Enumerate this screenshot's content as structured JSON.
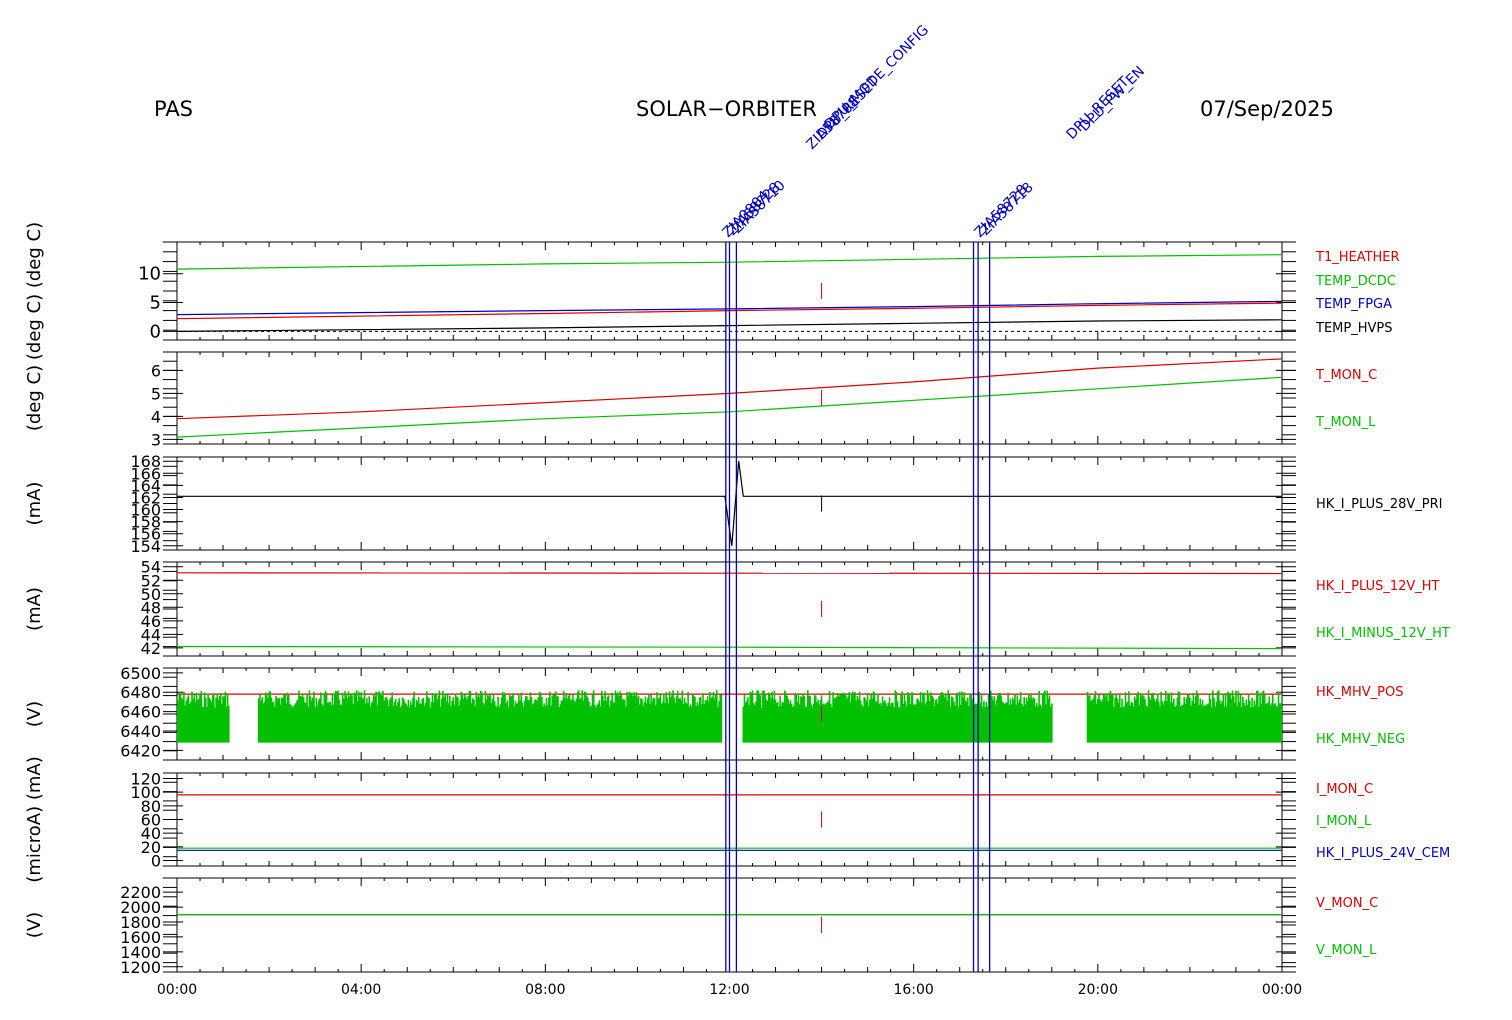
{
  "header": {
    "left": "PAS",
    "center": "SOLAR−ORBITER",
    "right": "07/Sep/2025"
  },
  "colors": {
    "red": "#dd0000",
    "green": "#00c000",
    "blue": "#0000c0",
    "black": "#000000"
  },
  "event_annotations": [
    "ZIA0804",
    "ZIA58728",
    "ZIA58710",
    "ZIA58708",
    "DPU_RESET",
    "DPU_MODE_CONFIG",
    "ZIA58728",
    "ZIA58718",
    "DPU_RESET",
    "DPU_PW_EN"
  ],
  "chart_data": {
    "type": "line",
    "x_axis": {
      "start": "00:00",
      "end": "00:00",
      "tick_labels": [
        "00:00",
        "04:00",
        "08:00",
        "12:00",
        "16:00",
        "20:00",
        "00:00"
      ]
    },
    "event_lines_hours": [
      11.92,
      12.0,
      12.15,
      17.3,
      17.4,
      17.65
    ],
    "panels": [
      {
        "ylabel": "(deg C)  (deg C)",
        "ylim": [
          -1.5,
          15.5
        ],
        "yticks": [
          "0",
          "5",
          "10"
        ],
        "ytick_values": [
          0,
          5,
          10
        ],
        "dashed_zero": true,
        "series": [
          {
            "name": "T1_HEATHER",
            "color": "red",
            "points": [
              [
                0,
                2.2
              ],
              [
                8,
                3.1
              ],
              [
                12,
                3.6
              ],
              [
                16,
                4.0
              ],
              [
                20,
                4.5
              ],
              [
                24,
                4.9
              ]
            ]
          },
          {
            "name": "TEMP_DCDC",
            "color": "green",
            "points": [
              [
                0,
                10.8
              ],
              [
                8,
                11.7
              ],
              [
                12,
                12.0
              ],
              [
                16,
                12.5
              ],
              [
                20,
                13.0
              ],
              [
                24,
                13.3
              ]
            ]
          },
          {
            "name": "TEMP_FPGA",
            "color": "blue",
            "points": [
              [
                0,
                2.9
              ],
              [
                8,
                3.6
              ],
              [
                12,
                3.9
              ],
              [
                16,
                4.3
              ],
              [
                20,
                4.8
              ],
              [
                24,
                5.2
              ]
            ]
          },
          {
            "name": "TEMP_HVPS",
            "color": "black",
            "points": [
              [
                0,
                0.0
              ],
              [
                8,
                0.6
              ],
              [
                12,
                1.0
              ],
              [
                16,
                1.4
              ],
              [
                20,
                1.8
              ],
              [
                24,
                2.0
              ]
            ]
          }
        ]
      },
      {
        "ylabel": "(deg C)",
        "ylim": [
          2.8,
          6.8
        ],
        "yticks": [
          "3",
          "4",
          "5",
          "6"
        ],
        "ytick_values": [
          3,
          4,
          5,
          6
        ],
        "series": [
          {
            "name": "T_MON_C",
            "color": "red",
            "points": [
              [
                0,
                3.9
              ],
              [
                4,
                4.2
              ],
              [
                8,
                4.6
              ],
              [
                12,
                5.0
              ],
              [
                16,
                5.5
              ],
              [
                20,
                6.1
              ],
              [
                24,
                6.5
              ]
            ]
          },
          {
            "name": "T_MON_L",
            "color": "green",
            "points": [
              [
                0,
                3.1
              ],
              [
                4,
                3.5
              ],
              [
                8,
                3.9
              ],
              [
                12,
                4.2
              ],
              [
                16,
                4.7
              ],
              [
                20,
                5.2
              ],
              [
                24,
                5.7
              ]
            ]
          }
        ]
      },
      {
        "ylabel": "(mA)",
        "ylim": [
          153.3,
          168.7
        ],
        "yticks": [
          "154",
          "156",
          "158",
          "160",
          "162",
          "164",
          "166",
          "168"
        ],
        "ytick_values": [
          154,
          156,
          158,
          160,
          162,
          164,
          166,
          168
        ],
        "series": [
          {
            "name": "HK_I_PLUS_28V_PRI",
            "color": "black",
            "points": [
              [
                0,
                162.2
              ],
              [
                11.9,
                162.2
              ],
              [
                12.05,
                154.0
              ],
              [
                12.2,
                168.0
              ],
              [
                12.3,
                162.2
              ],
              [
                24,
                162.2
              ]
            ]
          }
        ]
      },
      {
        "ylabel": "(mA)",
        "ylim": [
          40.8,
          54.7
        ],
        "yticks": [
          "42",
          "44",
          "46",
          "48",
          "50",
          "52",
          "54"
        ],
        "ytick_values": [
          42,
          44,
          46,
          48,
          50,
          52,
          54
        ],
        "series": [
          {
            "name": "HK_I_PLUS_12V_HT",
            "color": "red",
            "points": [
              [
                0,
                53.1
              ],
              [
                24,
                53.0
              ]
            ]
          },
          {
            "name": "HK_I_MINUS_12V_HT",
            "color": "green",
            "points": [
              [
                0,
                42.2
              ],
              [
                12,
                42.1
              ],
              [
                24,
                41.9
              ]
            ]
          }
        ]
      },
      {
        "ylabel": "(V)",
        "ylim": [
          6410,
          6505
        ],
        "yticks": [
          "6420",
          "6440",
          "6460",
          "6480",
          "6500"
        ],
        "ytick_values": [
          6420,
          6440,
          6460,
          6480,
          6500
        ],
        "series": [
          {
            "name": "HK_MHV_POS",
            "color": "red",
            "points": [
              [
                0,
                6478
              ],
              [
                24,
                6478
              ]
            ]
          },
          {
            "name": "HK_MHV_NEG",
            "color": "green",
            "band": [
              6428,
              6482
            ],
            "gaps_hours": [
              [
                1.15,
                1.75
              ],
              [
                11.85,
                12.3
              ],
              [
                19.0,
                19.75
              ]
            ]
          }
        ]
      },
      {
        "ylabel": "(microA)  (mA)",
        "ylim": [
          -8,
          128
        ],
        "yticks": [
          "0",
          "20",
          "40",
          "60",
          "80",
          "100",
          "120"
        ],
        "ytick_values": [
          0,
          20,
          40,
          60,
          80,
          100,
          120
        ],
        "series": [
          {
            "name": "I_MON_C",
            "color": "red",
            "points": [
              [
                0,
                96
              ],
              [
                12,
                96
              ],
              [
                24,
                96
              ]
            ]
          },
          {
            "name": "I_MON_L",
            "color": "green",
            "points": [
              [
                0,
                18
              ],
              [
                24,
                18
              ]
            ]
          },
          {
            "name": "HK_I_PLUS_24V_CEM",
            "color": "blue",
            "points": [
              [
                0,
                15
              ],
              [
                24,
                15
              ]
            ]
          }
        ]
      },
      {
        "ylabel": "(V)",
        "ylim": [
          1130,
          2390
        ],
        "yticks": [
          "1200",
          "1400",
          "1600",
          "1800",
          "2000",
          "2200"
        ],
        "ytick_values": [
          1200,
          1400,
          1600,
          1800,
          2000,
          2200
        ],
        "series": [
          {
            "name": "V_MON_C",
            "color": "red",
            "points": [
              [
                0,
                1900
              ],
              [
                24,
                1900
              ]
            ]
          },
          {
            "name": "V_MON_L",
            "color": "green",
            "points": [
              [
                0,
                1900
              ],
              [
                24,
                1900
              ]
            ]
          }
        ]
      }
    ]
  }
}
